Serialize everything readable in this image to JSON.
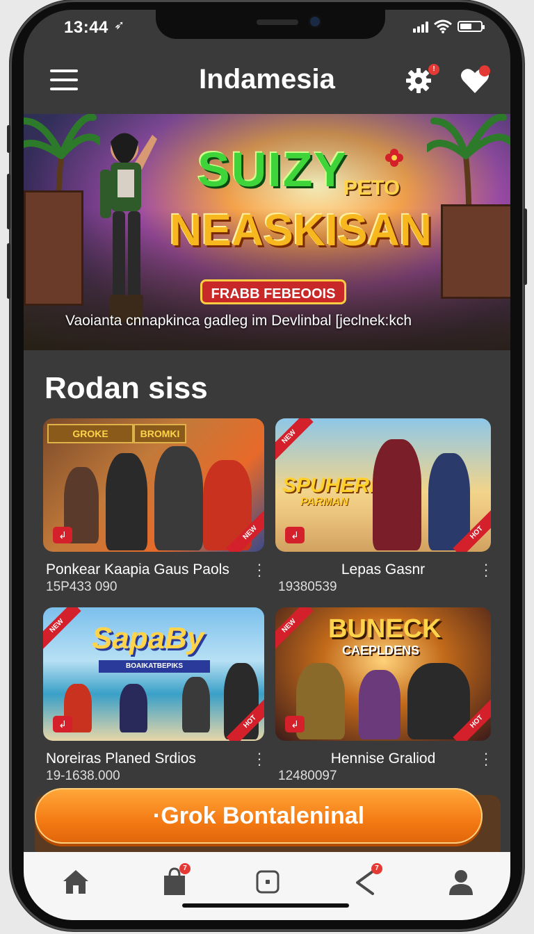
{
  "status_bar": {
    "time": "13:44"
  },
  "app": {
    "title": "Indamesia",
    "settings_badge": "!"
  },
  "hero": {
    "title_line1": "SUIZY",
    "title_sub": "PETO",
    "title_line2": "NEASKISAN",
    "badge": "FRABB FEBEOOIS",
    "caption": "Vaoianta cnnapkinca gadleg im Devlinbal [jeclnek:kch"
  },
  "section": {
    "title": "Rodan siss"
  },
  "games": [
    {
      "title": "Ponkear Kaapia Gaus Paols",
      "count": "15P433 090",
      "thumb_text": "GROKE",
      "thumb_text2": "BROMKI"
    },
    {
      "title": "Lepas Gasnr",
      "count": "19380539",
      "thumb_text": "SPUHERIN",
      "thumb_text2": "PARMAN"
    },
    {
      "title": "Noreiras Planed Srdios",
      "count": "19-1638.000",
      "thumb_text": "SapaBy",
      "thumb_text2": "BOAIKATBEPIKS"
    },
    {
      "title": "Hennise Graliod",
      "count": "12480097",
      "thumb_text": "BUNECK",
      "thumb_text2": "CAEPLDENS"
    }
  ],
  "cta": {
    "label": "·Grok Bontaleninal"
  },
  "tabbar": {
    "items": [
      {
        "name": "home",
        "icon": "home-icon"
      },
      {
        "name": "store",
        "icon": "bag-icon",
        "badge": "7"
      },
      {
        "name": "games",
        "icon": "square-icon"
      },
      {
        "name": "share",
        "icon": "share-icon",
        "badge": "7"
      },
      {
        "name": "profile",
        "icon": "user-icon"
      }
    ]
  },
  "colors": {
    "accent": "#f47a14",
    "badge": "#e53935",
    "background": "#3a3a3a"
  }
}
